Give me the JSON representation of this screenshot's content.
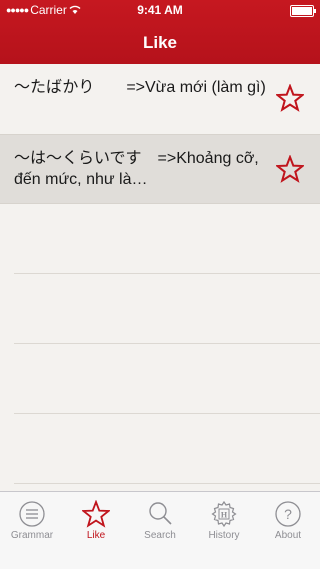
{
  "status": {
    "carrier": "Carrier",
    "time": "9:41 AM"
  },
  "nav": {
    "title": "Like"
  },
  "rows": [
    {
      "text": "〜たばかり　　=>Vừa mới (làm gì)",
      "favorited": true
    },
    {
      "text": "〜は〜くらいです　=>Khoảng cỡ, đến mức, như là…",
      "favorited": true
    }
  ],
  "tabs": [
    {
      "label": "Grammar",
      "icon": "grammar-icon",
      "active": false
    },
    {
      "label": "Like",
      "icon": "star-icon",
      "active": true
    },
    {
      "label": "Search",
      "icon": "search-icon",
      "active": false
    },
    {
      "label": "History",
      "icon": "history-icon",
      "active": false
    },
    {
      "label": "About",
      "icon": "help-icon",
      "active": false
    }
  ],
  "colors": {
    "header": "#b5121b",
    "accent": "#c0141c",
    "background": "#f4f2ef",
    "selected_row": "#e0ddd9"
  }
}
